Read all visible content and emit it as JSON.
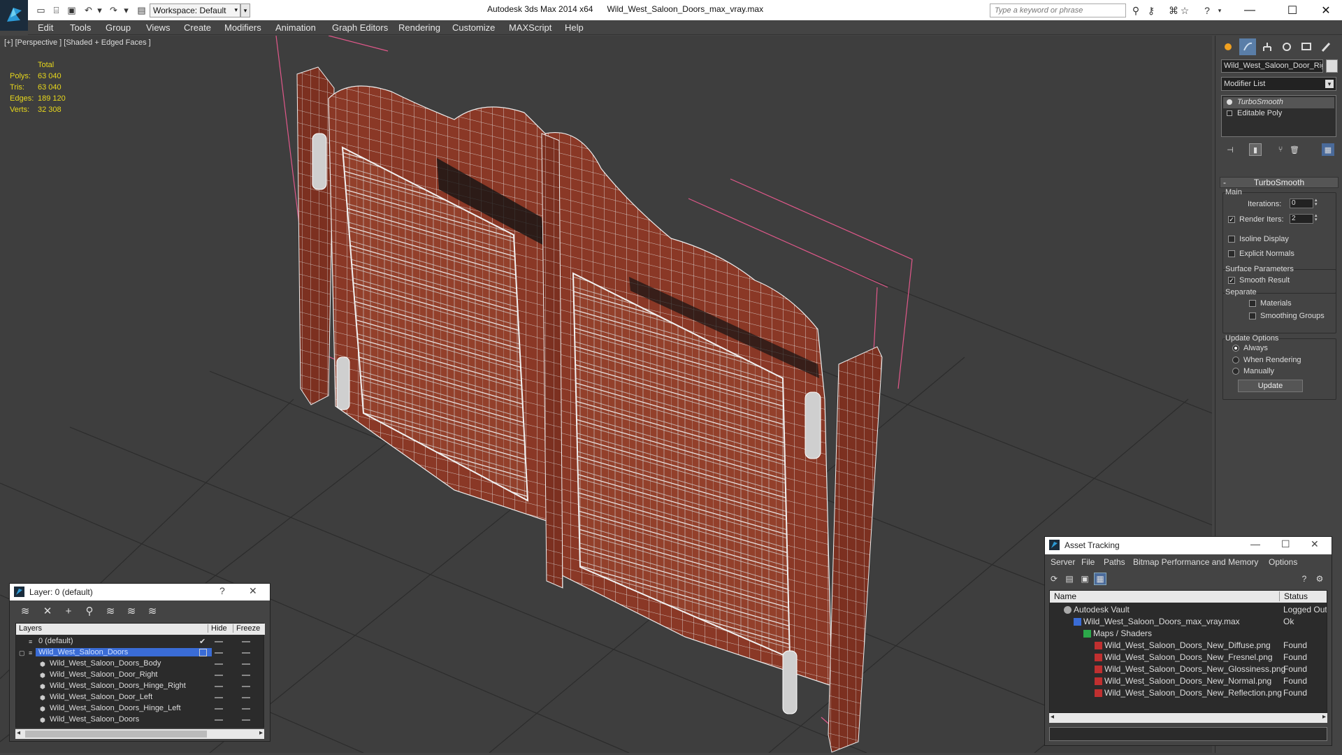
{
  "titlebar": {
    "app_name": "Autodesk 3ds Max  2014 x64",
    "file_name": "Wild_West_Saloon_Doors_max_vray.max",
    "workspace": "Workspace: Default",
    "search_placeholder": "Type a keyword or phrase"
  },
  "menu": [
    "Edit",
    "Tools",
    "Group",
    "Views",
    "Create",
    "Modifiers",
    "Animation",
    "Graph Editors",
    "Rendering",
    "Customize",
    "MAXScript",
    "Help"
  ],
  "viewport": {
    "label": "[+] [Perspective ] [Shaded + Edged Faces ]",
    "stats_header": "Total",
    "stats": [
      {
        "key": "Polys:",
        "value": "63 040"
      },
      {
        "key": "Tris:",
        "value": "63 040"
      },
      {
        "key": "Edges:",
        "value": "189 120"
      },
      {
        "key": "Verts:",
        "value": "32 308"
      }
    ]
  },
  "command_panel": {
    "object_name": "Wild_West_Saloon_Door_Rigl",
    "modifier_list": "Modifier List",
    "stack": [
      "TurboSmooth",
      "Editable Poly"
    ],
    "rollout_title": "TurboSmooth",
    "main_label": "Main",
    "iterations_label": "Iterations:",
    "iterations_value": "0",
    "render_iters_label": "Render Iters:",
    "render_iters_value": "2",
    "isoline": "Isoline Display",
    "explicit_normals": "Explicit Normals",
    "surface_params": "Surface Parameters",
    "smooth_result": "Smooth Result",
    "separate": "Separate",
    "materials": "Materials",
    "smoothing_groups": "Smoothing Groups",
    "update_options": "Update Options",
    "always": "Always",
    "when_rendering": "When Rendering",
    "manually": "Manually",
    "update_button": "Update"
  },
  "layer_window": {
    "title": "Layer: 0 (default)",
    "help": "?",
    "col_layers": "Layers",
    "col_hide": "Hide",
    "col_freeze": "Freeze",
    "rows": [
      {
        "name": "0 (default)",
        "indent": 1
      },
      {
        "name": "Wild_West_Saloon_Doors",
        "indent": 1
      },
      {
        "name": "Wild_West_Saloon_Doors_Body",
        "indent": 2
      },
      {
        "name": "Wild_West_Saloon_Door_Right",
        "indent": 2
      },
      {
        "name": "Wild_West_Saloon_Doors_Hinge_Right",
        "indent": 2
      },
      {
        "name": "Wild_West_Saloon_Door_Left",
        "indent": 2
      },
      {
        "name": "Wild_West_Saloon_Doors_Hinge_Left",
        "indent": 2
      },
      {
        "name": "Wild_West_Saloon_Doors",
        "indent": 2
      }
    ]
  },
  "asset_window": {
    "title": "Asset Tracking",
    "menu": [
      "Server",
      "File",
      "Paths",
      "Bitmap Performance and Memory",
      "Options"
    ],
    "col_name": "Name",
    "col_status": "Status",
    "rows": [
      {
        "name": "Autodesk Vault",
        "status": "Logged Out",
        "indent": 1,
        "icon": "vault"
      },
      {
        "name": "Wild_West_Saloon_Doors_max_vray.max",
        "status": "Ok",
        "indent": 2,
        "icon": "max"
      },
      {
        "name": "Maps / Shaders",
        "status": "",
        "indent": 3,
        "icon": "maps"
      },
      {
        "name": "Wild_West_Saloon_Doors_New_Diffuse.png",
        "status": "Found",
        "indent": 4,
        "icon": "png"
      },
      {
        "name": "Wild_West_Saloon_Doors_New_Fresnel.png",
        "status": "Found",
        "indent": 4,
        "icon": "png"
      },
      {
        "name": "Wild_West_Saloon_Doors_New_Glossiness.png",
        "status": "Found",
        "indent": 4,
        "icon": "png"
      },
      {
        "name": "Wild_West_Saloon_Doors_New_Normal.png",
        "status": "Found",
        "indent": 4,
        "icon": "png"
      },
      {
        "name": "Wild_West_Saloon_Doors_New_Reflection.png",
        "status": "Found",
        "indent": 4,
        "icon": "png"
      }
    ]
  },
  "colors": {
    "stats_text": "#e8d81c",
    "wood": "#8e3a26",
    "wireframe": "#dddddd",
    "bbox": "#e0588a",
    "selection": "#3a6cd6"
  }
}
